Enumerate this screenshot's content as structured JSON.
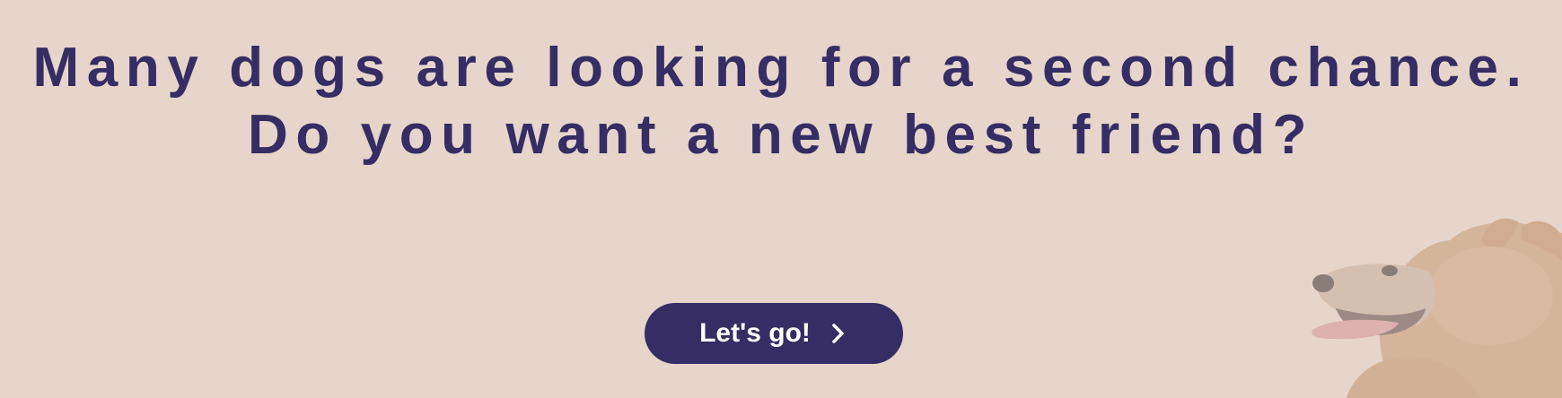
{
  "hero": {
    "headline_line1": "Many dogs are looking for a second chance.",
    "headline_line2": "Do you want a new best friend?",
    "cta_label": "Let's go!",
    "cta_icon": "chevron-right-icon",
    "image_icon": "pomeranian-dog-image"
  },
  "colors": {
    "background": "#e6d5cb",
    "accent": "#352d63",
    "cta_text": "#ffffff"
  }
}
